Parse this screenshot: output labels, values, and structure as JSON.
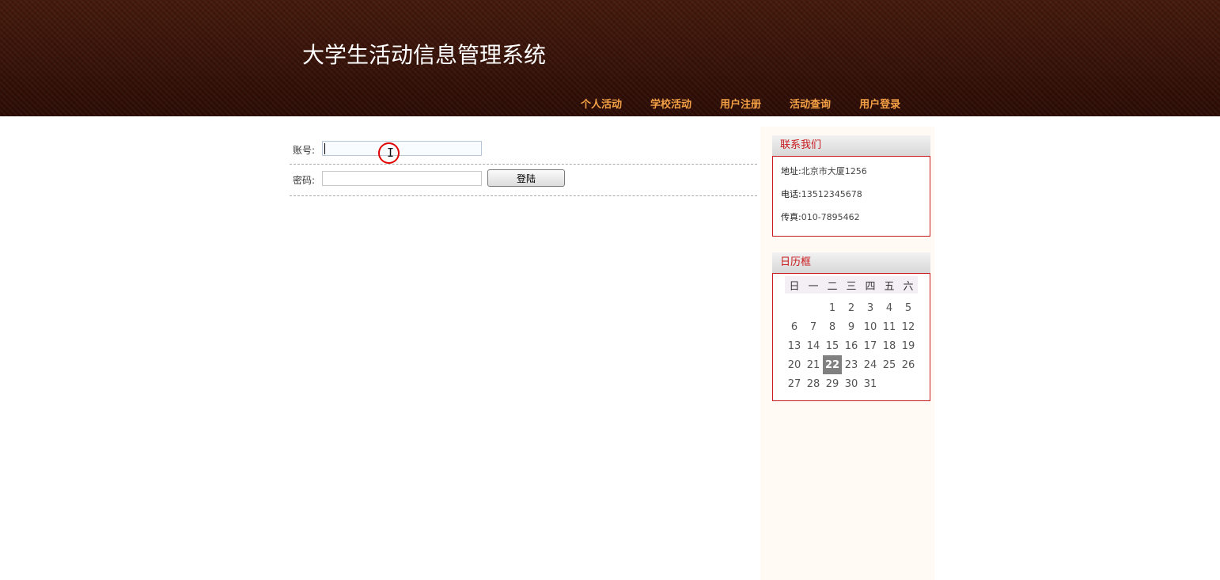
{
  "header": {
    "title": "大学生活动信息管理系统",
    "nav": [
      "个人活动",
      "学校活动",
      "用户注册",
      "活动查询",
      "用户登录"
    ]
  },
  "login": {
    "account_label": "账号:",
    "account_value": "",
    "password_label": "密码:",
    "password_value": "",
    "submit_label": "登陆"
  },
  "contact": {
    "title": "联系我们",
    "address_label": "地址:",
    "address": "北京市大厦1256",
    "phone_label": "电话:",
    "phone": "13512345678",
    "fax_label": "传真:",
    "fax": "010-7895462"
  },
  "calendar": {
    "title": "日历框",
    "weekdays": [
      "日",
      "一",
      "二",
      "三",
      "四",
      "五",
      "六"
    ],
    "weeks": [
      [
        "",
        "",
        "1",
        "2",
        "3",
        "4",
        "5"
      ],
      [
        "6",
        "7",
        "8",
        "9",
        "10",
        "11",
        "12"
      ],
      [
        "13",
        "14",
        "15",
        "16",
        "17",
        "18",
        "19"
      ],
      [
        "20",
        "21",
        "22",
        "23",
        "24",
        "25",
        "26"
      ],
      [
        "27",
        "28",
        "29",
        "30",
        "31",
        "",
        ""
      ]
    ],
    "today": "22"
  },
  "colors": {
    "header_bg": "#3a1208",
    "nav_text": "#f4a045",
    "accent_red": "#c8191c",
    "sidebar_bg": "#fffaf4"
  }
}
